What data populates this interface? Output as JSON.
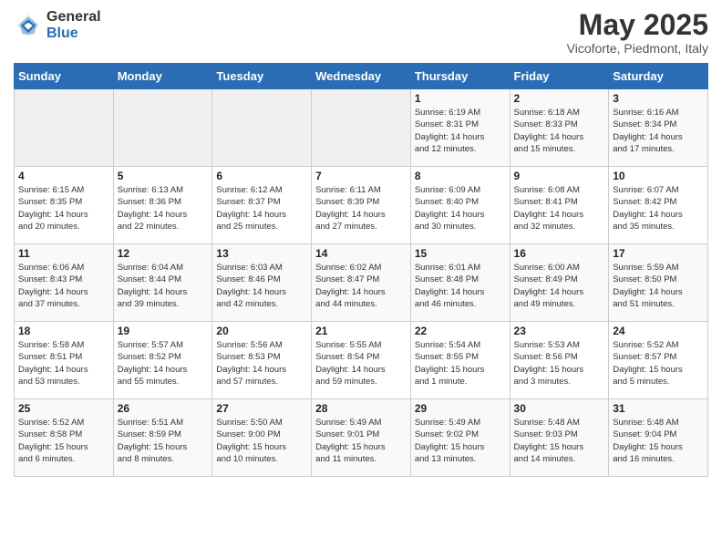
{
  "header": {
    "logo_general": "General",
    "logo_blue": "Blue",
    "month_title": "May 2025",
    "location": "Vicoforte, Piedmont, Italy"
  },
  "weekdays": [
    "Sunday",
    "Monday",
    "Tuesday",
    "Wednesday",
    "Thursday",
    "Friday",
    "Saturday"
  ],
  "weeks": [
    [
      {
        "day": "",
        "info": ""
      },
      {
        "day": "",
        "info": ""
      },
      {
        "day": "",
        "info": ""
      },
      {
        "day": "",
        "info": ""
      },
      {
        "day": "1",
        "info": "Sunrise: 6:19 AM\nSunset: 8:31 PM\nDaylight: 14 hours\nand 12 minutes."
      },
      {
        "day": "2",
        "info": "Sunrise: 6:18 AM\nSunset: 8:33 PM\nDaylight: 14 hours\nand 15 minutes."
      },
      {
        "day": "3",
        "info": "Sunrise: 6:16 AM\nSunset: 8:34 PM\nDaylight: 14 hours\nand 17 minutes."
      }
    ],
    [
      {
        "day": "4",
        "info": "Sunrise: 6:15 AM\nSunset: 8:35 PM\nDaylight: 14 hours\nand 20 minutes."
      },
      {
        "day": "5",
        "info": "Sunrise: 6:13 AM\nSunset: 8:36 PM\nDaylight: 14 hours\nand 22 minutes."
      },
      {
        "day": "6",
        "info": "Sunrise: 6:12 AM\nSunset: 8:37 PM\nDaylight: 14 hours\nand 25 minutes."
      },
      {
        "day": "7",
        "info": "Sunrise: 6:11 AM\nSunset: 8:39 PM\nDaylight: 14 hours\nand 27 minutes."
      },
      {
        "day": "8",
        "info": "Sunrise: 6:09 AM\nSunset: 8:40 PM\nDaylight: 14 hours\nand 30 minutes."
      },
      {
        "day": "9",
        "info": "Sunrise: 6:08 AM\nSunset: 8:41 PM\nDaylight: 14 hours\nand 32 minutes."
      },
      {
        "day": "10",
        "info": "Sunrise: 6:07 AM\nSunset: 8:42 PM\nDaylight: 14 hours\nand 35 minutes."
      }
    ],
    [
      {
        "day": "11",
        "info": "Sunrise: 6:06 AM\nSunset: 8:43 PM\nDaylight: 14 hours\nand 37 minutes."
      },
      {
        "day": "12",
        "info": "Sunrise: 6:04 AM\nSunset: 8:44 PM\nDaylight: 14 hours\nand 39 minutes."
      },
      {
        "day": "13",
        "info": "Sunrise: 6:03 AM\nSunset: 8:46 PM\nDaylight: 14 hours\nand 42 minutes."
      },
      {
        "day": "14",
        "info": "Sunrise: 6:02 AM\nSunset: 8:47 PM\nDaylight: 14 hours\nand 44 minutes."
      },
      {
        "day": "15",
        "info": "Sunrise: 6:01 AM\nSunset: 8:48 PM\nDaylight: 14 hours\nand 46 minutes."
      },
      {
        "day": "16",
        "info": "Sunrise: 6:00 AM\nSunset: 8:49 PM\nDaylight: 14 hours\nand 49 minutes."
      },
      {
        "day": "17",
        "info": "Sunrise: 5:59 AM\nSunset: 8:50 PM\nDaylight: 14 hours\nand 51 minutes."
      }
    ],
    [
      {
        "day": "18",
        "info": "Sunrise: 5:58 AM\nSunset: 8:51 PM\nDaylight: 14 hours\nand 53 minutes."
      },
      {
        "day": "19",
        "info": "Sunrise: 5:57 AM\nSunset: 8:52 PM\nDaylight: 14 hours\nand 55 minutes."
      },
      {
        "day": "20",
        "info": "Sunrise: 5:56 AM\nSunset: 8:53 PM\nDaylight: 14 hours\nand 57 minutes."
      },
      {
        "day": "21",
        "info": "Sunrise: 5:55 AM\nSunset: 8:54 PM\nDaylight: 14 hours\nand 59 minutes."
      },
      {
        "day": "22",
        "info": "Sunrise: 5:54 AM\nSunset: 8:55 PM\nDaylight: 15 hours\nand 1 minute."
      },
      {
        "day": "23",
        "info": "Sunrise: 5:53 AM\nSunset: 8:56 PM\nDaylight: 15 hours\nand 3 minutes."
      },
      {
        "day": "24",
        "info": "Sunrise: 5:52 AM\nSunset: 8:57 PM\nDaylight: 15 hours\nand 5 minutes."
      }
    ],
    [
      {
        "day": "25",
        "info": "Sunrise: 5:52 AM\nSunset: 8:58 PM\nDaylight: 15 hours\nand 6 minutes."
      },
      {
        "day": "26",
        "info": "Sunrise: 5:51 AM\nSunset: 8:59 PM\nDaylight: 15 hours\nand 8 minutes."
      },
      {
        "day": "27",
        "info": "Sunrise: 5:50 AM\nSunset: 9:00 PM\nDaylight: 15 hours\nand 10 minutes."
      },
      {
        "day": "28",
        "info": "Sunrise: 5:49 AM\nSunset: 9:01 PM\nDaylight: 15 hours\nand 11 minutes."
      },
      {
        "day": "29",
        "info": "Sunrise: 5:49 AM\nSunset: 9:02 PM\nDaylight: 15 hours\nand 13 minutes."
      },
      {
        "day": "30",
        "info": "Sunrise: 5:48 AM\nSunset: 9:03 PM\nDaylight: 15 hours\nand 14 minutes."
      },
      {
        "day": "31",
        "info": "Sunrise: 5:48 AM\nSunset: 9:04 PM\nDaylight: 15 hours\nand 16 minutes."
      }
    ]
  ]
}
